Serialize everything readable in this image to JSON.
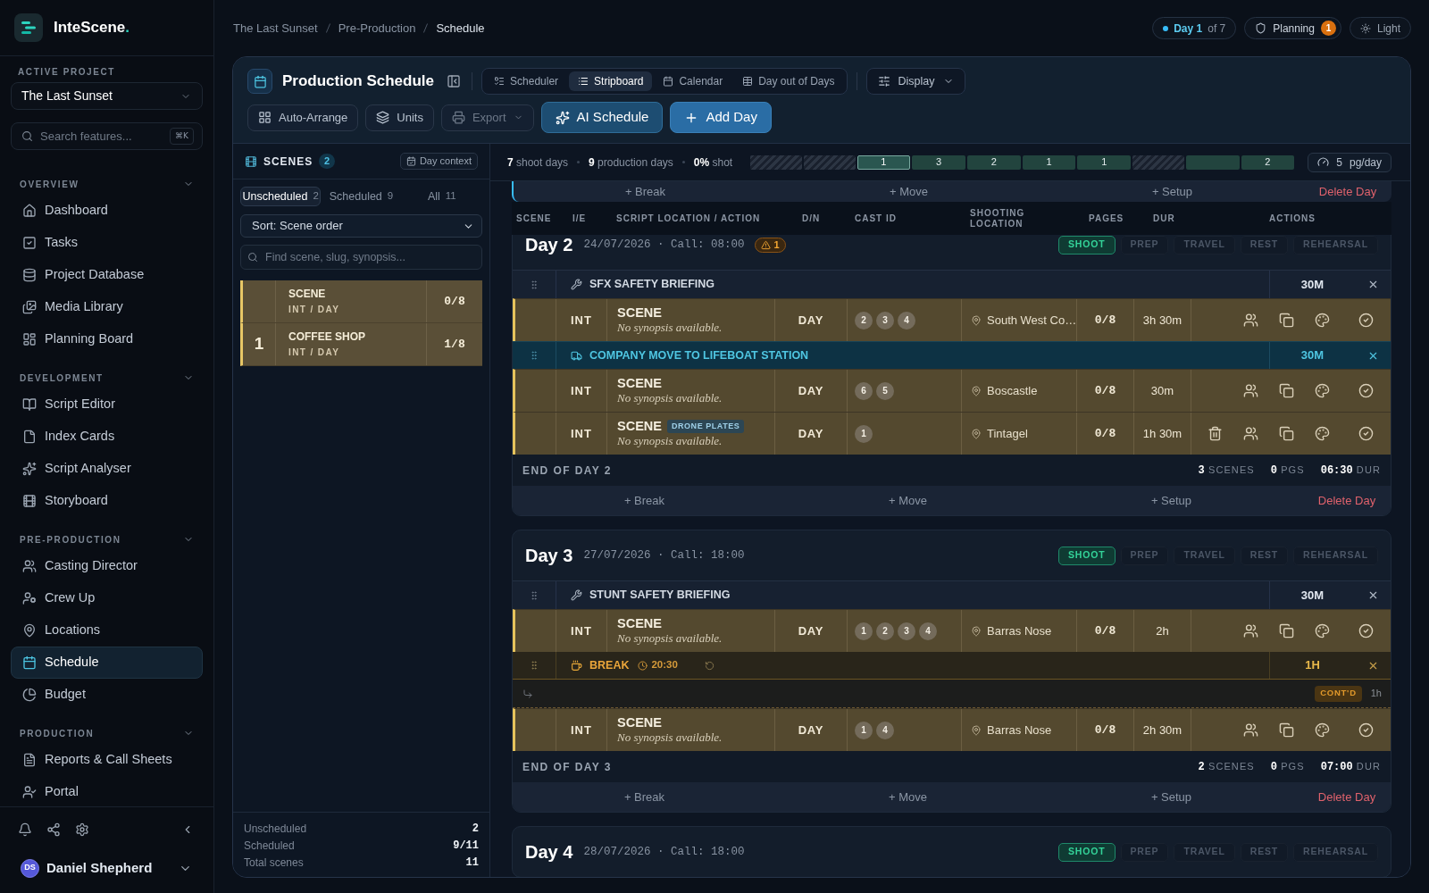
{
  "sidebar": {
    "brand": {
      "name": "InteScene",
      "dot": "."
    },
    "project": {
      "label": "ACTIVE PROJECT",
      "value": "The Last Sunset"
    },
    "search": {
      "placeholder": "Search features...",
      "shortcut": "⌘K"
    },
    "sections": [
      {
        "title": "OVERVIEW",
        "expanded": true,
        "items": [
          {
            "label": "Dashboard",
            "selected": false
          },
          {
            "label": "Tasks",
            "selected": false
          },
          {
            "label": "Project Database",
            "selected": false
          },
          {
            "label": "Media Library",
            "selected": false
          },
          {
            "label": "Planning Board",
            "selected": false
          }
        ]
      },
      {
        "title": "DEVELOPMENT",
        "expanded": true,
        "items": [
          {
            "label": "Script Editor",
            "selected": false
          },
          {
            "label": "Index Cards",
            "selected": false
          },
          {
            "label": "Script Analyser",
            "selected": false
          },
          {
            "label": "Storyboard",
            "selected": false
          }
        ]
      },
      {
        "title": "PRE-PRODUCTION",
        "expanded": true,
        "items": [
          {
            "label": "Casting Director",
            "selected": false
          },
          {
            "label": "Crew Up",
            "selected": false
          },
          {
            "label": "Locations",
            "selected": false
          },
          {
            "label": "Schedule",
            "selected": true
          },
          {
            "label": "Budget",
            "selected": false
          }
        ]
      },
      {
        "title": "PRODUCTION",
        "expanded": true,
        "items": [
          {
            "label": "Reports & Call Sheets",
            "selected": false
          },
          {
            "label": "Portal",
            "selected": false
          }
        ]
      }
    ],
    "user": {
      "initials": "DS",
      "name": "Daniel Shepherd"
    }
  },
  "breadcrumb": [
    "The Last Sunset",
    "Pre-Production",
    "Schedule"
  ],
  "status": {
    "day": {
      "current": "Day 1",
      "total": "of 7"
    },
    "mode": {
      "label": "Planning",
      "count": "1"
    },
    "theme": {
      "label": "Light"
    }
  },
  "panel": {
    "title": "Production Schedule",
    "views": [
      {
        "label": "Scheduler",
        "selected": false
      },
      {
        "label": "Stripboard",
        "selected": true
      },
      {
        "label": "Calendar",
        "selected": false
      },
      {
        "label": "Day out of Days",
        "selected": false
      }
    ],
    "display": "Display",
    "actions": [
      {
        "kind": "secondary",
        "label": "Auto-Arrange",
        "disabled": false
      },
      {
        "kind": "secondary",
        "label": "Units",
        "disabled": false
      },
      {
        "kind": "menu",
        "label": "Export",
        "disabled": true
      },
      {
        "kind": "ai",
        "label": "AI Schedule",
        "disabled": false
      },
      {
        "kind": "primary",
        "label": "Add Day",
        "disabled": false
      }
    ]
  },
  "scenes_panel": {
    "title": "SCENES",
    "count": "2",
    "context_button": "Day context",
    "filters": [
      {
        "label": "Unscheduled",
        "count": "2",
        "selected": true
      },
      {
        "label": "Scheduled",
        "count": "9",
        "selected": false
      },
      {
        "label": "All",
        "count": "11",
        "selected": false
      }
    ],
    "sort": "Sort: Scene order",
    "search": {
      "placeholder": "Find scene, slug, synopsis..."
    },
    "items": [
      {
        "title": "SCENE",
        "slug": "INT / DAY",
        "pages": "0/8"
      },
      {
        "number": "1",
        "title": "COFFEE SHOP",
        "slug": "INT / DAY",
        "pages": "1/8"
      }
    ],
    "totals": [
      {
        "label": "Unscheduled",
        "value": "2"
      },
      {
        "label": "Scheduled",
        "value": "9/11"
      },
      {
        "label": "Total scenes",
        "value": "11"
      }
    ]
  },
  "schedule": {
    "summary": [
      "**7** shoot days",
      "**9** production days",
      "**0%** shot"
    ],
    "timeline": [
      {
        "kind": "off"
      },
      {
        "kind": "off"
      },
      {
        "kind": "day",
        "label": "1",
        "selected": true
      },
      {
        "kind": "day",
        "label": "3",
        "selected": false
      },
      {
        "kind": "day",
        "label": "2",
        "selected": false
      },
      {
        "kind": "day",
        "label": "1",
        "selected": false
      },
      {
        "kind": "day",
        "label": "1",
        "selected": false
      },
      {
        "kind": "off"
      },
      {
        "kind": "day",
        "selected": false
      },
      {
        "kind": "day",
        "label": "2",
        "selected": false
      }
    ],
    "pace": {
      "value": "5",
      "unit": "pg/day"
    },
    "previous_day_footer": {
      "add": [
        "+ Break",
        "+ Move",
        "+ Setup"
      ],
      "delete": "Delete Day"
    },
    "columns": [
      "SCENE",
      "I/E",
      "SCRIPT LOCATION / ACTION",
      "D/N",
      "CAST ID",
      "SHOOTING LOCATION",
      "PAGES",
      "DUR",
      "ACTIONS"
    ],
    "days": [
      {
        "title": "Day 2",
        "meta": "24/07/2026 · Call: 08:00",
        "warnings": "1",
        "types": [
          {
            "label": "SHOOT",
            "selected": true
          },
          {
            "label": "PREP",
            "selected": false
          },
          {
            "label": "TRAVEL",
            "selected": false
          },
          {
            "label": "REST",
            "selected": false
          },
          {
            "label": "REHEARSAL",
            "selected": false
          }
        ],
        "rows": [
          {
            "kind": "briefing",
            "label": "SFX SAFETY BRIEFING",
            "duration": "30M"
          },
          {
            "kind": "scene",
            "ie": "INT",
            "title": "SCENE",
            "synopsis": "No synopsis available.",
            "dn": "DAY",
            "cast": [
              "2",
              "3",
              "4"
            ],
            "location": "South West Co…",
            "pages": "0/8",
            "duration": "3h 30m",
            "can_delete": false
          },
          {
            "kind": "move",
            "label": "COMPANY MOVE TO LIFEBOAT STATION",
            "duration": "30M"
          },
          {
            "kind": "scene",
            "ie": "INT",
            "title": "SCENE",
            "synopsis": "No synopsis available.",
            "dn": "DAY",
            "cast": [
              "6",
              "5"
            ],
            "location": "Boscastle",
            "pages": "0/8",
            "duration": "30m",
            "can_delete": false
          },
          {
            "kind": "scene",
            "ie": "INT",
            "title": "SCENE",
            "tag": "DRONE PLATES",
            "synopsis": "No synopsis available.",
            "dn": "DAY",
            "cast": [
              "1"
            ],
            "location": "Tintagel",
            "pages": "0/8",
            "duration": "1h 30m",
            "can_delete": true
          }
        ],
        "end": {
          "label": "END OF DAY 2",
          "stats": [
            "**3** SCENES",
            "**0** PGS",
            "**06:30** DUR"
          ]
        },
        "add": [
          "+ Break",
          "+ Move",
          "+ Setup"
        ],
        "delete": "Delete Day"
      },
      {
        "title": "Day 3",
        "meta": "27/07/2026 · Call: 18:00",
        "types": [
          {
            "label": "SHOOT",
            "selected": true
          },
          {
            "label": "PREP",
            "selected": false
          },
          {
            "label": "TRAVEL",
            "selected": false
          },
          {
            "label": "REST",
            "selected": false
          },
          {
            "label": "REHEARSAL",
            "selected": false
          }
        ],
        "rows": [
          {
            "kind": "briefing",
            "label": "STUNT SAFETY BRIEFING",
            "duration": "30M"
          },
          {
            "kind": "scene",
            "ie": "INT",
            "title": "SCENE",
            "synopsis": "No synopsis available.",
            "dn": "DAY",
            "cast": [
              "1",
              "2",
              "3",
              "4"
            ],
            "location": "Barras Nose",
            "pages": "0/8",
            "duration": "2h",
            "can_delete": false
          },
          {
            "kind": "break",
            "label": "BREAK",
            "time": "20:30",
            "duration": "1H"
          },
          {
            "kind": "continued",
            "badge": "CONT'D",
            "duration": "1h"
          },
          {
            "kind": "scene",
            "ie": "INT",
            "title": "SCENE",
            "synopsis": "No synopsis available.",
            "dn": "DAY",
            "cast": [
              "1",
              "4"
            ],
            "location": "Barras Nose",
            "pages": "0/8",
            "duration": "2h 30m",
            "can_delete": false
          }
        ],
        "end": {
          "label": "END OF DAY 3",
          "stats": [
            "**2** SCENES",
            "**0** PGS",
            "**07:00** DUR"
          ]
        },
        "add": [
          "+ Break",
          "+ Move",
          "+ Setup"
        ],
        "delete": "Delete Day"
      },
      {
        "title": "Day 4",
        "meta": "28/07/2026 · Call: 18:00",
        "types": [
          {
            "label": "SHOOT",
            "selected": true
          },
          {
            "label": "PREP",
            "selected": false
          },
          {
            "label": "TRAVEL",
            "selected": false
          },
          {
            "label": "REST",
            "selected": false
          },
          {
            "label": "REHEARSAL",
            "selected": false
          }
        ]
      }
    ]
  }
}
